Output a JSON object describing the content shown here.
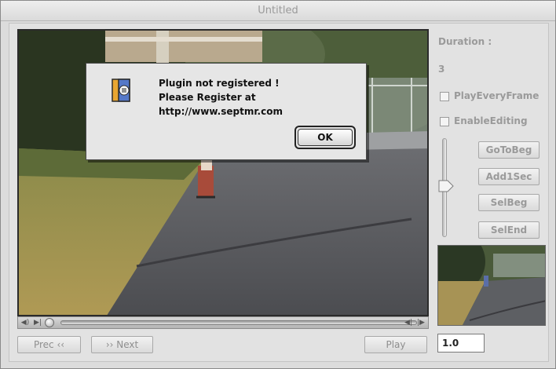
{
  "window": {
    "title": "Untitled"
  },
  "dialog": {
    "icon": "plugin-alert-icon",
    "message_lines": [
      "Plugin not registered !",
      "Please Register at",
      "http://www.septmr.com"
    ],
    "ok_label": "OK"
  },
  "sidebar": {
    "duration_label": "Duration :",
    "duration_value": "3",
    "play_every_frame_label": "PlayEveryFrame",
    "play_every_frame_checked": false,
    "enable_editing_label": "EnableEditing",
    "enable_editing_checked": false,
    "buttons": {
      "go_to_beg": "GoToBeg",
      "add_1_sec": "Add1Sec",
      "sel_beg": "SelBeg",
      "sel_end": "SelEnd"
    },
    "rate_value": "1.0"
  },
  "controls": {
    "prev_label": "Prec ‹‹",
    "next_label": "›› Next",
    "play_label": "Play"
  },
  "colors": {
    "window_bg": "#dcdcdc",
    "disabled_text": "#9a9a9a",
    "dialog_bg": "#e6e6e6"
  }
}
